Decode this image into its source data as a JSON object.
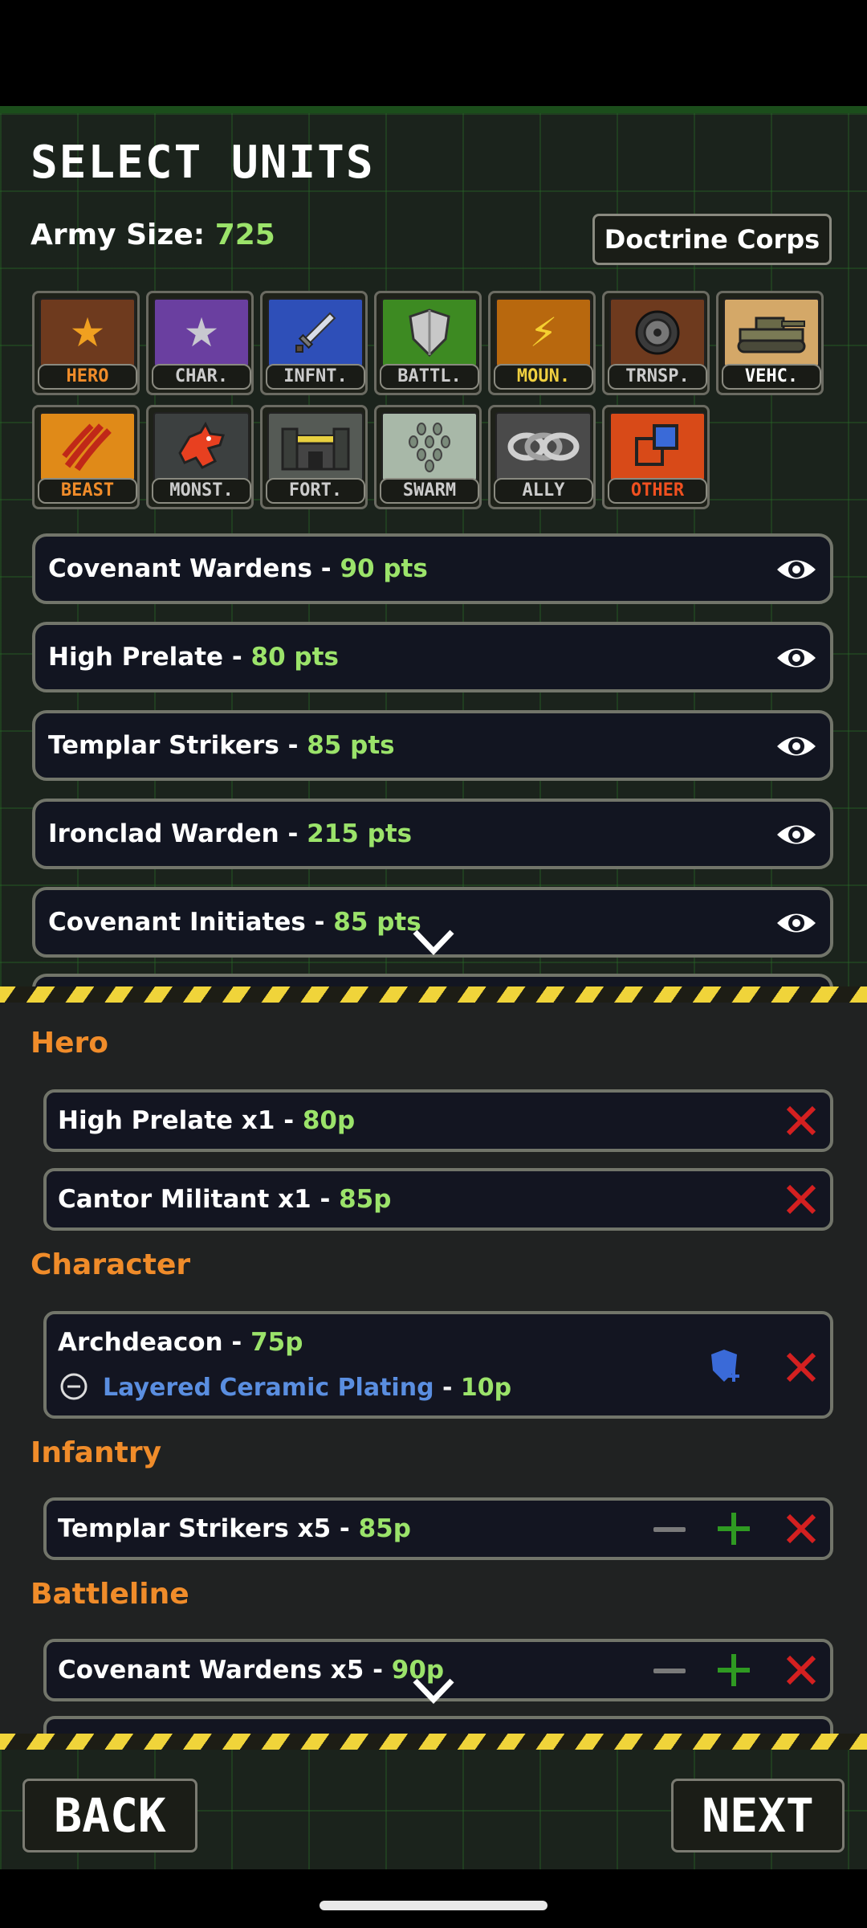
{
  "header": {
    "title": "SELECT UNITS",
    "army_label": "Army Size: ",
    "army_value": "725",
    "doctrine": "Doctrine Corps"
  },
  "categories": [
    {
      "label": "HERO",
      "icon": "laurel-star-icon",
      "bg": "#6e3a1e",
      "color": "#f0a020",
      "glyph": "★"
    },
    {
      "label": "CHAR.",
      "icon": "purple-star-badge-icon",
      "bg": "#6a3fa0",
      "color": "#c8c8d0",
      "glyph": "★"
    },
    {
      "label": "INFNT.",
      "icon": "sword-icon",
      "bg": "#2e4fb8",
      "color": "#d0d8e8",
      "glyph": "🗡"
    },
    {
      "label": "BATTL.",
      "icon": "shield-icon",
      "bg": "#3d8a22",
      "color": "#d0d0d0",
      "glyph": "⛨"
    },
    {
      "label": "MOUN.",
      "icon": "lightning-icon",
      "bg": "#b8680e",
      "color": "#f5d030",
      "glyph": "⚡"
    },
    {
      "label": "TRNSP.",
      "icon": "wheel-icon",
      "bg": "#6e3a1e",
      "color": "#bbbbbb",
      "glyph": "◉"
    },
    {
      "label": "VEHC.",
      "icon": "tank-icon",
      "bg": "#d4a868",
      "color": "#5a5a3a",
      "glyph": "▬"
    },
    {
      "label": "BEAST",
      "icon": "claw-icon",
      "bg": "#e08a18",
      "color": "#f04020",
      "glyph": "⫽"
    },
    {
      "label": "MONST.",
      "icon": "dragon-icon",
      "bg": "#3c4040",
      "color": "#e84020",
      "glyph": "♞"
    },
    {
      "label": "FORT.",
      "icon": "fortress-icon",
      "bg": "#555a55",
      "color": "#e8d040",
      "glyph": "♜"
    },
    {
      "label": "SWARM",
      "icon": "swarm-icon",
      "bg": "#a8b8a8",
      "color": "#5a6a5a",
      "glyph": "⁂"
    },
    {
      "label": "ALLY",
      "icon": "chain-link-icon",
      "bg": "#4a4a4a",
      "color": "#cccccc",
      "glyph": "∞"
    },
    {
      "label": "OTHER",
      "icon": "squares-icon",
      "bg": "#d84a18",
      "color": "#3a6ad8",
      "glyph": "◩"
    }
  ],
  "units": [
    {
      "name": "Covenant Wardens",
      "sep": " - ",
      "pts": "90 pts"
    },
    {
      "name": "High Prelate",
      "sep": " - ",
      "pts": "80 pts"
    },
    {
      "name": "Templar Strikers",
      "sep": " - ",
      "pts": "85 pts"
    },
    {
      "name": "Ironclad Warden",
      "sep": " - ",
      "pts": "215 pts"
    },
    {
      "name": "Covenant Initiates",
      "sep": " - ",
      "pts": "85 pts"
    }
  ],
  "sections": {
    "hero": "Hero",
    "character": "Character",
    "infantry": "Infantry",
    "battleline": "Battleline"
  },
  "selected": {
    "hero": [
      {
        "name": "High Prelate  x1",
        "sep": " - ",
        "pts": "80p"
      },
      {
        "name": "Cantor Militant  x1",
        "sep": " - ",
        "pts": "85p"
      }
    ],
    "character": [
      {
        "name": "Archdeacon",
        "sep": " - ",
        "pts": "75p",
        "upgrade": "Layered Ceramic Plating",
        "upgrade_sep": " - ",
        "upgrade_pts": "10p"
      }
    ],
    "infantry": [
      {
        "name": "Templar Strikers  x5",
        "sep": " - ",
        "pts": "85p"
      }
    ],
    "battleline": [
      {
        "name": "Covenant Wardens  x5",
        "sep": " - ",
        "pts": "90p"
      }
    ]
  },
  "footer": {
    "back": "BACK",
    "next": "NEXT"
  },
  "colors": {
    "accent_green": "#9be36a",
    "section_orange": "#f08c2a",
    "remove_red": "#d42020",
    "add_green": "#2f9a22",
    "upgrade_blue": "#5a8ee0"
  }
}
